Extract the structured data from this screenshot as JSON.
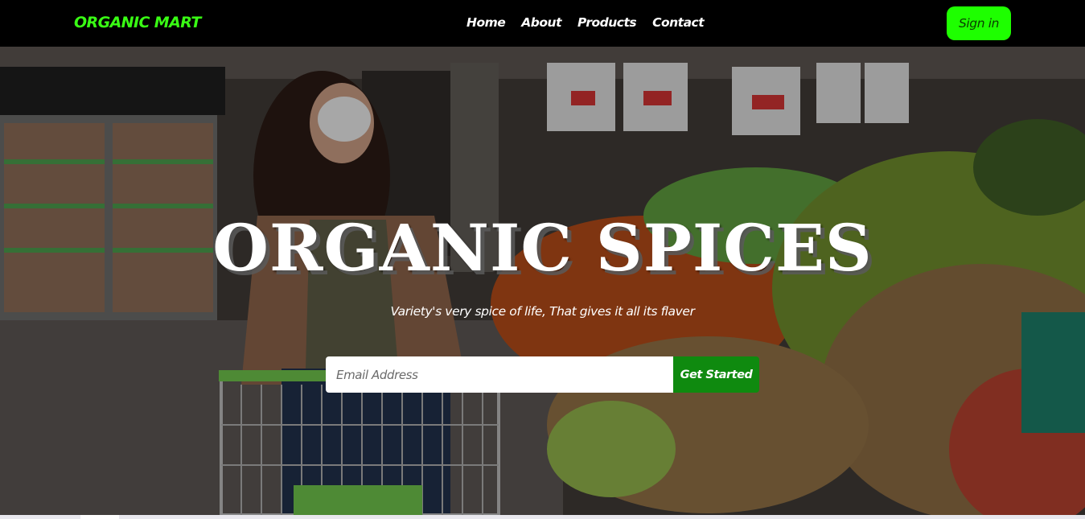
{
  "navbar": {
    "brand": "ORGANIC MART",
    "links": [
      "Home",
      "About",
      "Products",
      "Contact"
    ],
    "signin_label": "Sign in"
  },
  "hero": {
    "title": "ORGANIC SPICES",
    "tagline": "Variety's very spice of life, That gives it all its flaver",
    "email_placeholder": "Email Address",
    "cta_label": "Get Started",
    "background": "supermarket-produce-photo"
  },
  "colors": {
    "brand_green": "#39ff14",
    "signin_green": "#1eff00",
    "cta_green": "#0f8a0f",
    "navbar_bg": "#000000"
  }
}
